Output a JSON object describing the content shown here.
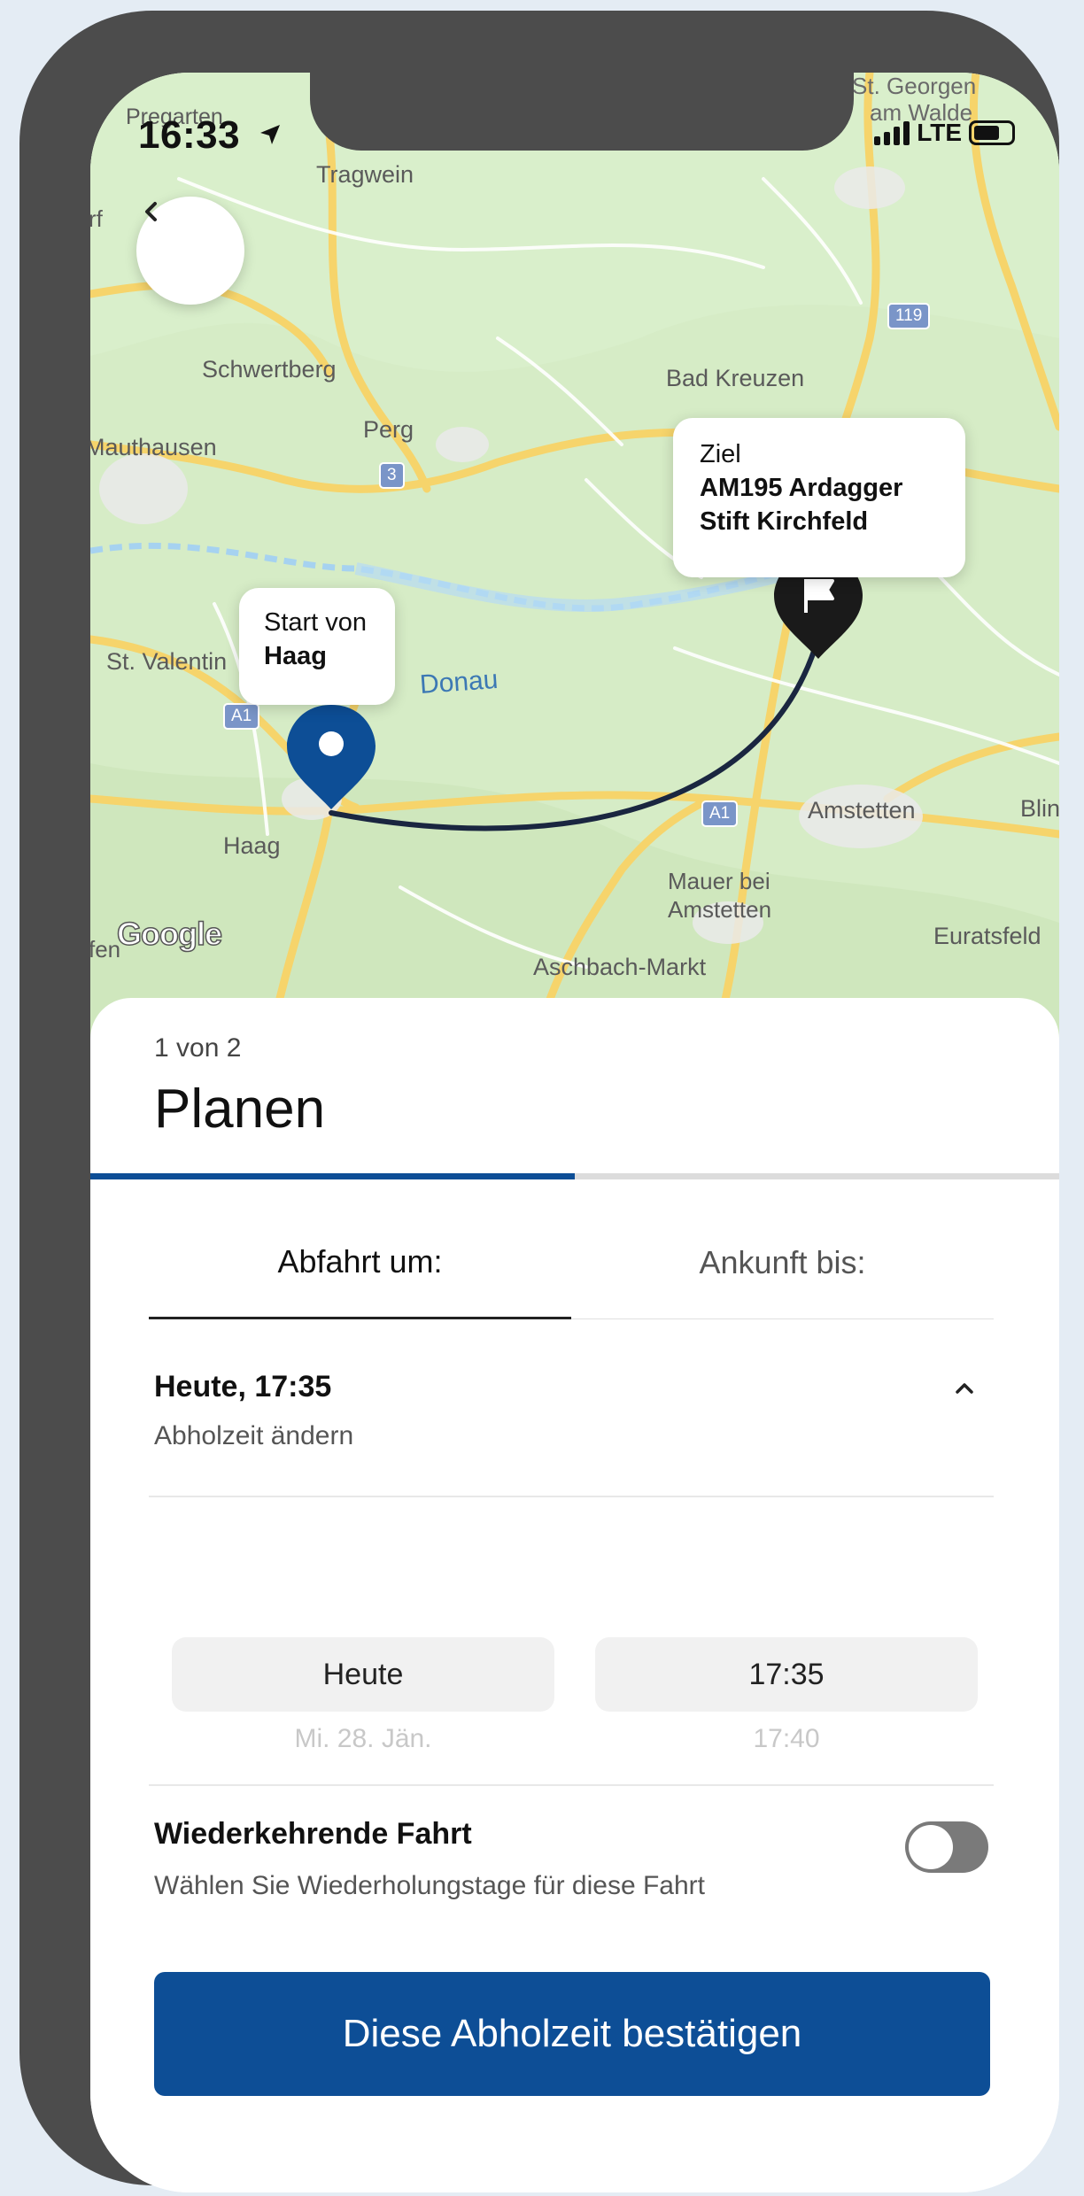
{
  "status_bar": {
    "time": "16:33",
    "network": "LTE"
  },
  "map": {
    "start_callout": {
      "line1": "Start von",
      "line2": "Haag"
    },
    "destination_callout": {
      "line1": "Ziel",
      "line2": "AM195 Ardagger",
      "line3": "Stift Kirchfeld"
    },
    "place_labels": {
      "pregarten": "Pregarten",
      "tragwein": "Tragwein",
      "st_georgen": "St. Georgen",
      "am_walde": "am Walde",
      "schwertberg": "Schwertberg",
      "bad_kreuzen": "Bad Kreuzen",
      "mauthausen": "Mauthausen",
      "perg": "Perg",
      "st_valentin": "St. Valentin",
      "donau": "Donau",
      "haag": "Haag",
      "amstetten": "Amstetten",
      "blin": "Blin",
      "mauer_bei": "Mauer bei",
      "mauer_amstetten": "Amstetten",
      "euratsfeld": "Euratsfeld",
      "aschbach": "Aschbach-Markt",
      "fen": "fen",
      "rf": "rf"
    },
    "road_shields": {
      "r119": "119",
      "r3": "3",
      "a1_left": "A1",
      "a1_right": "A1"
    },
    "attribution": "Google",
    "colors": {
      "route": "#1a2640",
      "start_pin": "#0d4e96",
      "destination_pin": "#1a1a1a"
    }
  },
  "sheet": {
    "step_indicator": "1 von 2",
    "title": "Planen",
    "progress_fraction": 0.5,
    "tabs": {
      "departure": "Abfahrt um:",
      "arrival": "Ankunft bis:"
    },
    "pickup": {
      "title": "Heute, 17:35",
      "subtitle": "Abholzeit ändern"
    },
    "picker": {
      "day_selected": "Heute",
      "day_next": "Mi. 28. Jän.",
      "time_selected": "17:35",
      "time_next": "17:40"
    },
    "recurring": {
      "title": "Wiederkehrende Fahrt",
      "subtitle": "Wählen Sie Wiederholungstage für diese Fahrt",
      "enabled": false
    },
    "confirm_label": "Diese Abholzeit bestätigen",
    "accent_color": "#0d4e96"
  }
}
